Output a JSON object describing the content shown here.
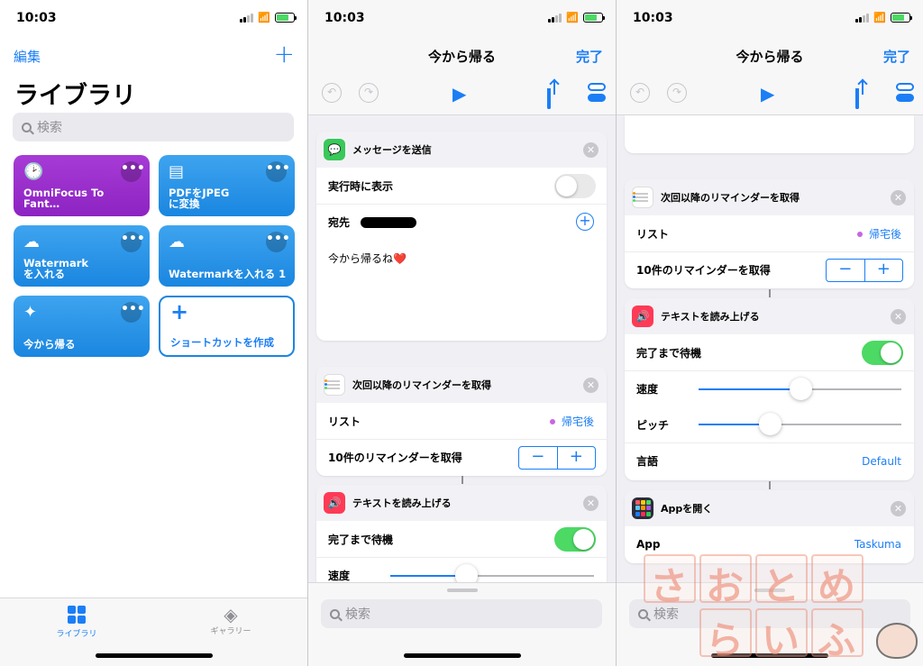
{
  "status": {
    "time": "10:03"
  },
  "library": {
    "edit": "編集",
    "add": "+",
    "title": "ライブラリ",
    "search_placeholder": "検索",
    "tiles": [
      {
        "label": "OmniFocus To Fant…",
        "icon": "clock-icon"
      },
      {
        "label": "PDFをJPEG\nに変換",
        "icon": "document-icon"
      },
      {
        "label": "Watermark\nを入れる",
        "icon": "cloud-icon"
      },
      {
        "label": "Watermarkを入れる 1",
        "icon": "cloud-icon"
      },
      {
        "label": "今から帰る",
        "icon": "magic-wand-icon"
      },
      {
        "label": "ショートカットを作成",
        "icon": "plus-icon"
      }
    ],
    "more": "•••",
    "tabs": {
      "library": "ライブラリ",
      "gallery": "ギャラリー"
    }
  },
  "editor": {
    "title": "今から帰る",
    "done": "完了",
    "message": {
      "header": "メッセージを送信",
      "show_when_run": "実行時に表示",
      "recipient": "宛先",
      "body": "今から帰るね❤️"
    },
    "reminders": {
      "header": "次回以降のリマインダーを取得",
      "list_label": "リスト",
      "list_value": "帰宅後",
      "count_label": "10件のリマインダーを取得"
    },
    "speak": {
      "header": "テキストを読み上げる",
      "wait": "完了まで待機",
      "rate": "速度",
      "pitch": "ピッチ",
      "language": "言語",
      "language_value": "Default",
      "rate_value": 0.37,
      "pitch_value": 0.35,
      "rate_value_p3": 0.5
    },
    "open_app": {
      "header": "Appを開く",
      "app_label": "App",
      "app_value": "Taskuma"
    },
    "search_placeholder": "検索"
  },
  "watermark": {
    "chars": [
      "さ",
      "お",
      "と",
      "め",
      "ら",
      "い",
      "ふ"
    ]
  },
  "colors": {
    "accent": "#1b7ef5",
    "switch_on": "#4cd964",
    "purple_tile": "#9b2fcc",
    "blue_tile": "#2b95e8"
  }
}
